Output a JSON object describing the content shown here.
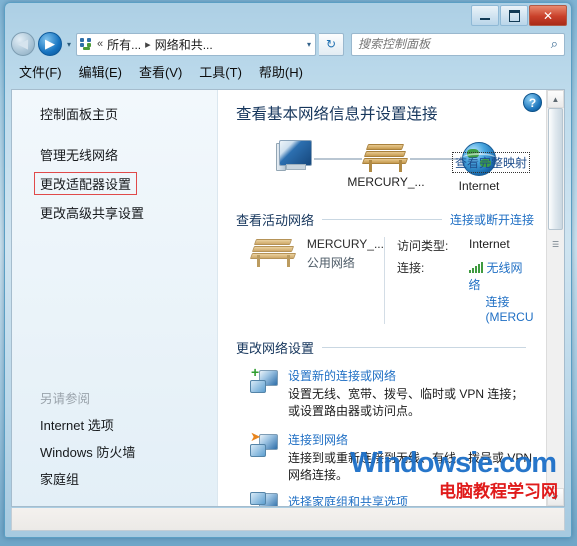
{
  "window": {
    "controls": {
      "minimize": "–",
      "maximize": "□",
      "close": "✕"
    }
  },
  "addressbar": {
    "back_glyph": "◀",
    "forward_glyph": "▶",
    "dropdown_glyph": "▾",
    "separator": "«",
    "crumb_arrow": "▸",
    "crumb_first": "所有...",
    "crumb_second": "网络和共...",
    "caret": "▾",
    "refresh_glyph": "↻"
  },
  "search": {
    "placeholder": "搜索控制面板",
    "value": "",
    "icon": "search-icon",
    "glyph": "⌕"
  },
  "menubar": {
    "items": [
      {
        "label": "文件(F)"
      },
      {
        "label": "编辑(E)"
      },
      {
        "label": "查看(V)"
      },
      {
        "label": "工具(T)"
      },
      {
        "label": "帮助(H)"
      }
    ]
  },
  "sidebar": {
    "home": "控制面板主页",
    "tasks": [
      {
        "label": "管理无线网络",
        "highlighted": false
      },
      {
        "label": "更改适配器设置",
        "highlighted": true
      },
      {
        "label": "更改高级共享设置",
        "highlighted": false
      }
    ],
    "see_also_header": "另请参阅",
    "see_also": [
      {
        "label": "Internet 选项"
      },
      {
        "label": "Windows 防火墙"
      },
      {
        "label": "家庭组"
      }
    ],
    "highlight_color": "#e04a4a"
  },
  "main": {
    "help_glyph": "?",
    "page_title": "查看基本网络信息并设置连接",
    "map": {
      "computer_label": "",
      "network_label": "MERCURY_...",
      "internet_label": "Internet",
      "full_map_link": "查看完整映射"
    },
    "active_section": {
      "title": "查看活动网络",
      "right_link": "连接或断开连接",
      "network_name": "MERCURY_...",
      "network_type": "公用网络",
      "access_key": "访问类型:",
      "access_value": "Internet",
      "connection_key": "连接:",
      "connection_value_line1": "无线网络",
      "connection_value_line2": "连接",
      "connection_value_line3": "(MERCU"
    },
    "change_section": {
      "title": "更改网络设置",
      "items": [
        {
          "title": "设置新的连接或网络",
          "desc": "设置无线、宽带、拨号、临时或 VPN 连接；或设置路由器或访问点。",
          "icon": "new-connection-icon"
        },
        {
          "title": "连接到网络",
          "desc": "连接到或重新连接到无线、有线、拨号或 VPN 网络连接。",
          "icon": "connect-network-icon"
        }
      ],
      "cut_item": {
        "title": "选择家庭组和共享选项",
        "icon": "homegroup-icon"
      }
    },
    "scrollbar": {
      "up": "▲",
      "down": "▼",
      "grip": "☰"
    }
  },
  "watermark": {
    "blue_text": "Windowsie.com",
    "red_text": "电脑教程学习网"
  },
  "colors": {
    "accent_link": "#1f6fc4",
    "heading": "#16365c",
    "highlight_red": "#e04a4a",
    "close_red": "#c9402a"
  }
}
